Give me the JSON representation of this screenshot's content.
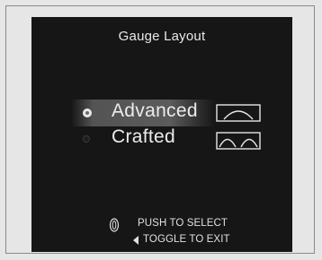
{
  "screen": {
    "title": "Gauge Layout",
    "options": [
      {
        "label": "Advanced",
        "selected": true,
        "icon": "single-dial-gauge-icon"
      },
      {
        "label": "Crafted",
        "selected": false,
        "icon": "twin-dial-gauge-icon"
      }
    ],
    "hints": {
      "push": "PUSH TO SELECT",
      "toggle": "TOGGLE TO EXIT"
    }
  },
  "colors": {
    "screen_background": "#161616",
    "text": "#e8e8e8",
    "selection_highlight": "#5f5f5f"
  }
}
